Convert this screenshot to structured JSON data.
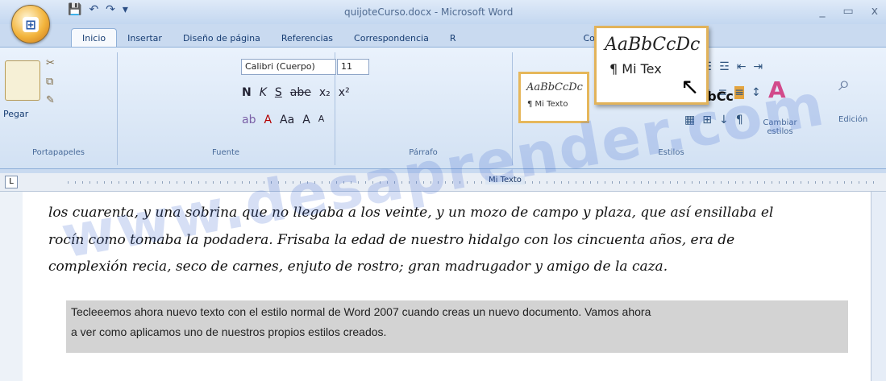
{
  "window": {
    "title": "quijoteCurso.docx - Microsoft Word",
    "controls": [
      "_",
      "▭",
      "x"
    ]
  },
  "quick_access": {
    "save_icon": "💾",
    "undo_icon": "↶",
    "redo_icon": "↷",
    "more_icon": "▾"
  },
  "tabs": [
    {
      "label": "Inicio"
    },
    {
      "label": "Insertar"
    },
    {
      "label": "Diseño de página"
    },
    {
      "label": "Referencias"
    },
    {
      "label": "Correspondencia"
    },
    {
      "label": "R"
    },
    {
      "label": "Complementos"
    }
  ],
  "ribbon": {
    "clipboard": {
      "paste_label": "Pegar",
      "group_label": "Portapapeles"
    },
    "font": {
      "font_name": "Calibri (Cuerpo)",
      "font_size": "11",
      "bold": "N",
      "italic": "K",
      "underline": "S",
      "strike": "abe",
      "subscript": "x₂",
      "superscript": "x²",
      "group_label": "Fuente",
      "format": "A",
      "case": "Aa",
      "grow": "A",
      "shrink": "A"
    },
    "paragraph": {
      "group_label": "Párrafo",
      "show_marks": "¶"
    },
    "styles": {
      "group_label": "Estilos",
      "preview_big": "AaBbCcDc",
      "preview_text": "¶ Mi Texto",
      "second_style": "BbCc",
      "change_styles_label": "Cambiar estilos",
      "edit_label": "Edición"
    }
  },
  "popup": {
    "big": "AaBbCcDc",
    "small": "¶ Mi Tex"
  },
  "ruler_label": "Mi Texto",
  "document": {
    "handwriting": [
      "los cuarenta, y una sobrina que no llegaba a los veinte, y un mozo de campo y plaza, que así ensillaba el",
      "rocín como tomaba la podadera. Frisaba la edad de nuestro hidalgo con los cincuenta años, era de",
      "complexión recia, seco de carnes, enjuto de rostro; gran madrugador y amigo de la caza."
    ],
    "normal_text": [
      "Tecleeemos ahora nuevo texto con el estilo normal de Word 2007 cuando creas un nuevo documento. Vamos ahora",
      "a ver como aplicamos uno de nuestros propios estilos creados."
    ]
  },
  "watermark": "www.desaprender.com"
}
